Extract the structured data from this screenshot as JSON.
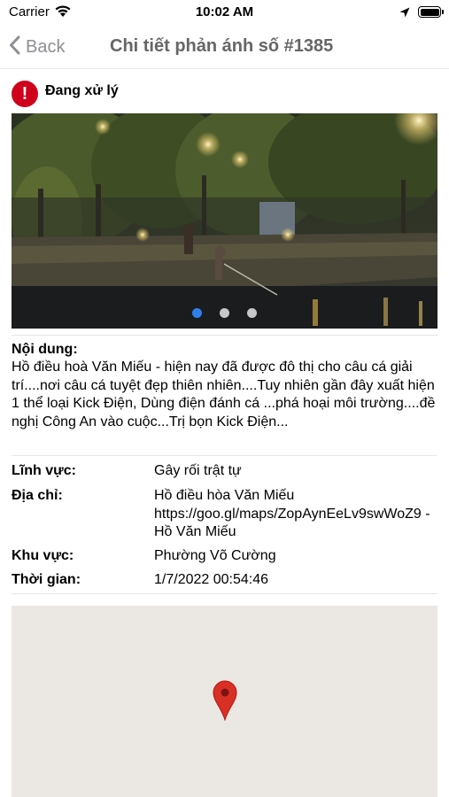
{
  "status_bar": {
    "carrier": "Carrier",
    "time": "10:02 AM",
    "wifi_icon": "wifi-icon",
    "location_icon": "location-arrow-icon",
    "battery_icon": "battery-icon"
  },
  "nav": {
    "back_label": "Back",
    "title": "Chi tiết phản ánh số #1385",
    "back_icon": "chevron-left-icon"
  },
  "report": {
    "status_label": "Đang xử lý",
    "status_icon": "exclamation-circle-icon",
    "status_color": "#d0021b",
    "photo": {
      "total": 3,
      "current": 1,
      "active_dot_color": "#2f80ed"
    },
    "content_label": "Nội dung:",
    "content_text": "Hồ điều hoà Văn Miếu - hiện nay đã được đô thị cho câu cá giải trí....nơi câu cá tuyệt đẹp thiên nhiên....Tuy nhiên gần đây xuất hiện 1 thể loại Kick Điện, Dùng điện đánh cá ...phá hoại môi trường....đề nghị Công An vào cuộc...Trị bọn Kick Điện...",
    "fields": {
      "field_label": "Lĩnh vực:",
      "field_value": "Gây rối trật tự",
      "address_label": "Địa chỉ:",
      "address_value": "Hồ điều hòa Văn Miếu https://goo.gl/maps/ZopAynEeLv9swWoZ9 - Hồ Văn Miếu",
      "area_label": "Khu vực:",
      "area_value": "Phường Võ Cường",
      "time_label": "Thời gian:",
      "time_value": "1/7/2022 00:54:46"
    },
    "map": {
      "pin_icon": "map-pin-icon",
      "pin_color": "#d93025"
    }
  }
}
